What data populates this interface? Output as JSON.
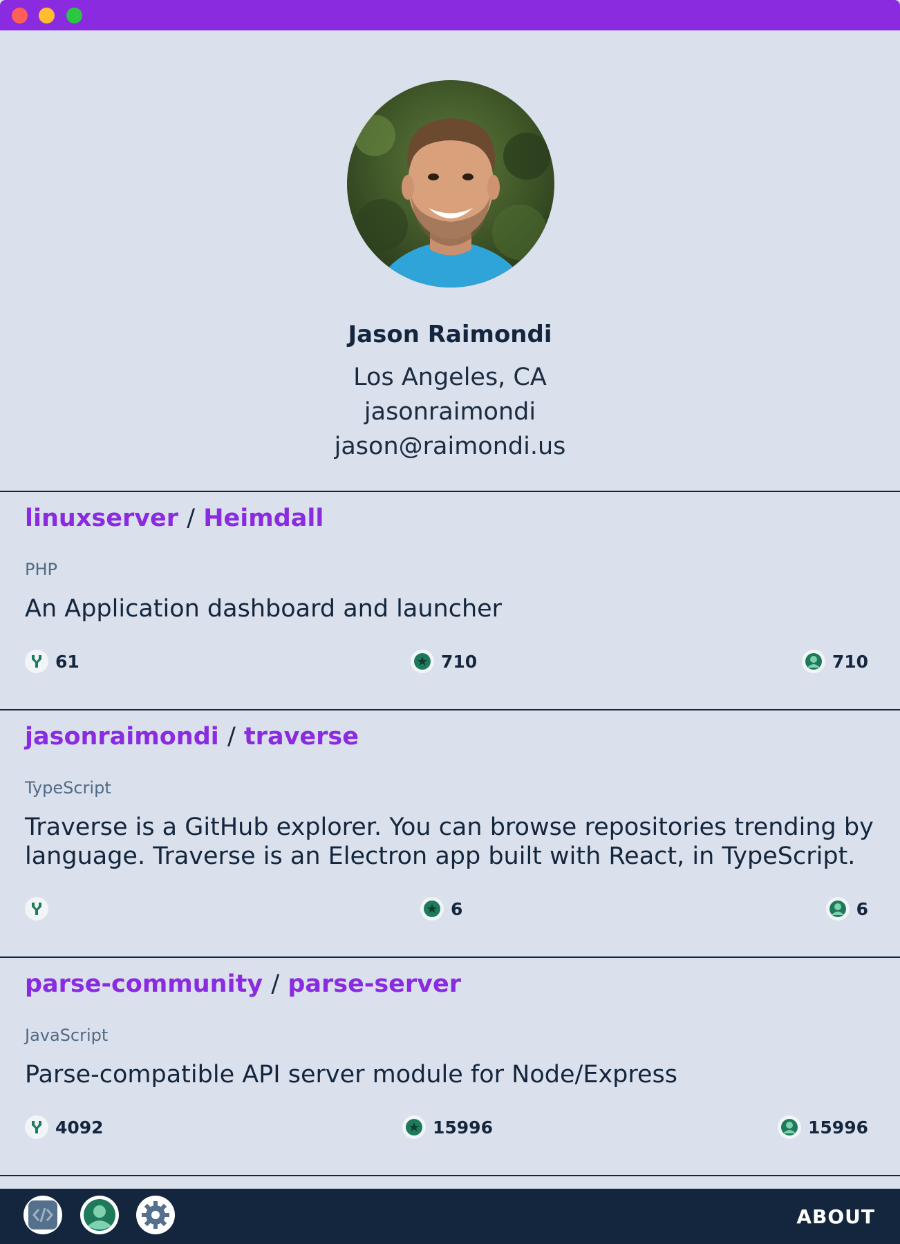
{
  "profile": {
    "name": "Jason Raimondi",
    "location": "Los Angeles, CA",
    "username": "jasonraimondi",
    "email": "jason@raimondi.us"
  },
  "repos": [
    {
      "owner": "linuxserver",
      "separator": "/",
      "name": "Heimdall",
      "language": "PHP",
      "description": "An Application dashboard and launcher",
      "forks": "61",
      "stars": "710",
      "watchers": "710"
    },
    {
      "owner": "jasonraimondi",
      "separator": "/",
      "name": "traverse",
      "language": "TypeScript",
      "description": "Traverse is a GitHub explorer. You can browse repositories trending by language. Traverse is an Electron app built with React, in TypeScript.",
      "forks": "",
      "stars": "6",
      "watchers": "6"
    },
    {
      "owner": "parse-community",
      "separator": "/",
      "name": "parse-server",
      "language": "JavaScript",
      "description": "Parse-compatible API server module for Node/Express",
      "forks": "4092",
      "stars": "15996",
      "watchers": "15996"
    }
  ],
  "nav": {
    "about_label": "ABOUT",
    "icons": [
      "code-icon",
      "user-icon",
      "gear-icon"
    ]
  },
  "colors": {
    "accent": "#8a2be0",
    "background": "#dae1ec",
    "dark": "#14263d",
    "stat_green": "#1f7a5c"
  }
}
